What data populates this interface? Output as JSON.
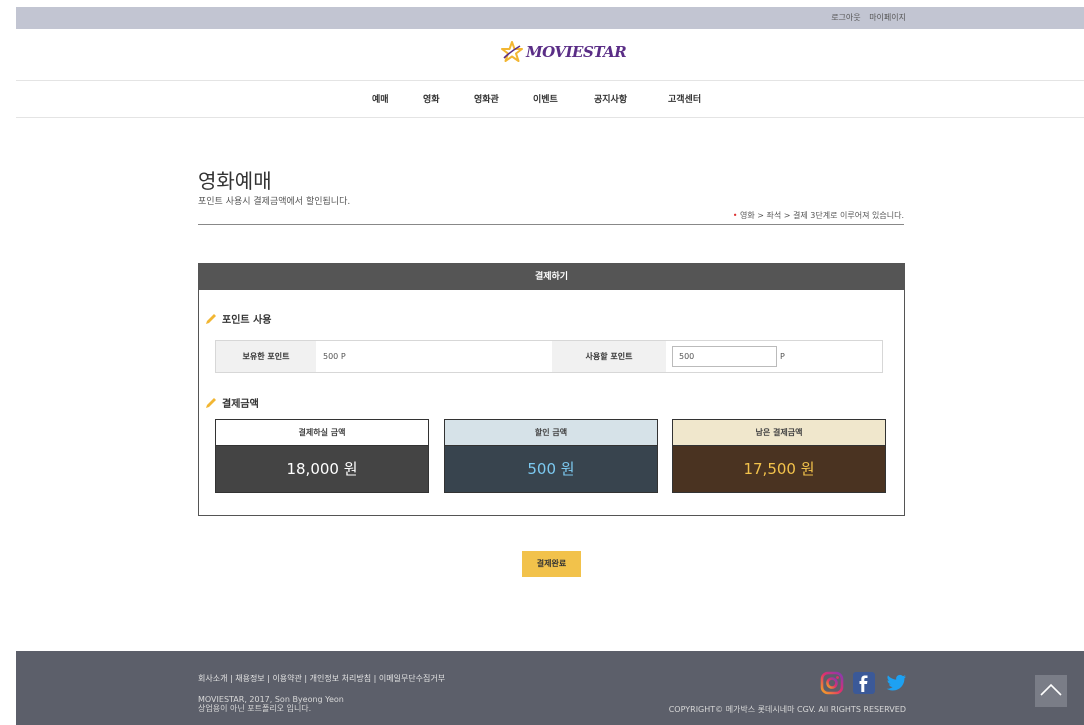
{
  "topbar": {
    "logout": "로그아웃",
    "mypage": "마이페이지"
  },
  "logo": {
    "text": "MOVIESTAR"
  },
  "nav": [
    "예매",
    "영화",
    "영화관",
    "이벤트",
    "공지사항",
    "고객센터"
  ],
  "page": {
    "title": "영화예매",
    "desc": "포인트 사용시 결제금액에서 할인됩니다.",
    "steps_marker": "•",
    "steps": "영화 > 좌석 > 결제 3단계로 이루어져 있습니다."
  },
  "payment": {
    "header": "결제하기",
    "point_section": "포인트 사용",
    "owned_label": "보유한 포인트",
    "owned_value": "500 P",
    "use_label": "사용할 포인트",
    "use_value": "500",
    "use_unit": "P",
    "amount_section": "결제금액",
    "amounts": [
      {
        "label": "결제하실 금액",
        "value": "18,000 원"
      },
      {
        "label": "할인 금액",
        "value": "500 원"
      },
      {
        "label": "남은 결제금액",
        "value": "17,500 원"
      }
    ]
  },
  "complete_button": "결제완료",
  "footer": {
    "links": "회사소개 | 채용정보 | 이용약관 | 개인정보 처리방침 | 이메일무단수집거부",
    "info_line1": "MOVIESTAR, 2017, Son Byeong Yeon",
    "info_line2": "상업용이 아닌 포트폴리오 입니다.",
    "copyright": "COPYRIGHT© 메가박스 롯데시네마 CGV. All RIGHTS RESERVED"
  },
  "colors": {
    "amount1_bg": "#444444",
    "amount1_label_bg": "#ffffff",
    "amount2_bg": "#38444e",
    "amount2_label_bg": "#d6e2e8",
    "amount2_text": "#7cc9f0",
    "amount3_bg": "#4a3321",
    "amount3_label_bg": "#f0e7cc",
    "amount3_text": "#f2c24b",
    "accent": "#f2c24b"
  }
}
